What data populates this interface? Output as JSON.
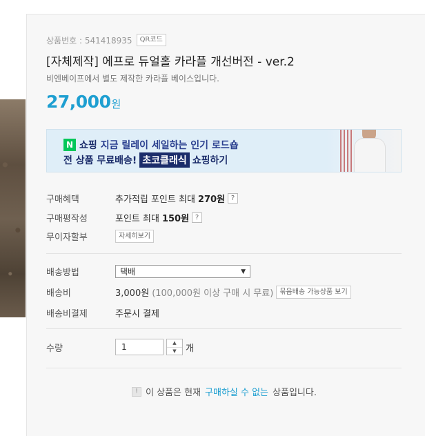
{
  "product": {
    "code_label": "상품번호 : ",
    "code_value": "541418935",
    "qr_label": "QR코드",
    "title": "[자체제작] 에프로 듀얼홀 카라플 개선버전 - ver.2",
    "subtitle": "비엔베이프에서 별도 제작한 카라플 베이스입니다.",
    "price_number": "27,000",
    "price_unit": "원"
  },
  "banner": {
    "n_badge": "N",
    "shopping": "쇼핑",
    "line1_text": "지금 릴레이 세일하는 인기 로드숍",
    "line2_prefix": "전 상품 무료배송!",
    "line2_highlight": "초코클래식",
    "line2_suffix": "쇼핑하기"
  },
  "benefits": {
    "purchase_label": "구매혜택",
    "purchase_text": "추가적립 포인트 최대",
    "purchase_amount": "270원",
    "review_label": "구매평작성",
    "review_text": "포인트 최대",
    "review_amount": "150원",
    "installment_label": "무이자할부",
    "installment_button": "자세히보기",
    "help_glyph": "?"
  },
  "shipping": {
    "method_label": "배송방법",
    "method_value": "택배",
    "fee_label": "배송비",
    "fee_value": "3,000원",
    "fee_condition": "(100,000원 이상 구매 시 무료)",
    "bundle_button": "묶음배송 가능상품 보기",
    "payment_label": "배송비결제",
    "payment_value": "주문시 결제"
  },
  "quantity": {
    "label": "수량",
    "value": "1",
    "unit": "개",
    "up": "▲",
    "down": "▼"
  },
  "notice": {
    "icon": "!",
    "prefix": "이 상품은 현재",
    "link": "구매하실 수 없는",
    "suffix": "상품입니다."
  }
}
